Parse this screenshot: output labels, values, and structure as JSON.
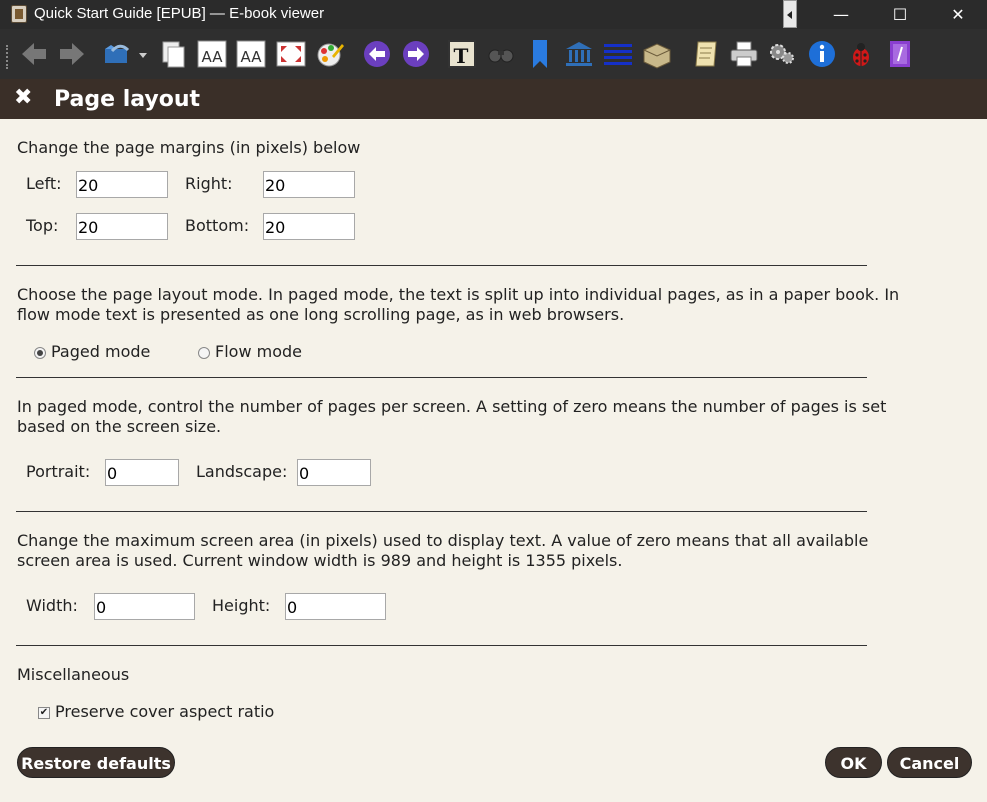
{
  "window": {
    "title": "Quick Start Guide [EPUB] — E-book viewer",
    "minimize": "—",
    "maximize": "☐",
    "close": "✕"
  },
  "toolbar": {
    "icons": [
      "back-icon",
      "forward-icon",
      "open-ebook-icon",
      "dropdown-arrow-icon",
      "copy-icon",
      "font-larger-icon",
      "font-smaller-icon",
      "fullscreen-icon",
      "color-schemes-icon",
      "previous-page-icon",
      "next-page-icon",
      "font-settings-icon",
      "find-icon",
      "bookmark-icon",
      "reference-mode-icon",
      "table-of-contents-icon",
      "page-layout-icon",
      "scroll-icon",
      "print-icon",
      "preferences-icon",
      "info-icon",
      "debug-icon",
      "theme-icon"
    ]
  },
  "panel": {
    "close_glyph": "✖",
    "title": "Page layout"
  },
  "margins": {
    "heading": "Change the page margins (in pixels) below",
    "left_label": "Left:",
    "left_value": "20",
    "right_label": "Right:",
    "right_value": "20",
    "top_label": "Top:",
    "top_value": "20",
    "bottom_label": "Bottom:",
    "bottom_value": "20"
  },
  "layout_mode": {
    "desc_line1": "Choose the page layout mode. In paged mode, the text is split up into individual pages, as in a paper book. In",
    "desc_line2": "flow mode text is presented as one long scrolling page, as in web browsers.",
    "paged_label": "Paged mode",
    "flow_label": "Flow mode",
    "selected": "paged"
  },
  "pages_per_screen": {
    "desc_line1": "In paged mode, control the number of pages per screen. A setting of zero means the number of pages is set",
    "desc_line2": "based on the screen size.",
    "portrait_label": "Portrait:",
    "portrait_value": "0",
    "landscape_label": "Landscape:",
    "landscape_value": "0"
  },
  "screen_area": {
    "desc_line1": "Change the maximum screen area (in pixels) used to display text. A value of zero means that all available",
    "desc_line2": "screen area is used. Current window width is 989 and height is 1355 pixels.",
    "width_label": "Width:",
    "width_value": "0",
    "height_label": "Height:",
    "height_value": "0"
  },
  "misc": {
    "heading": "Miscellaneous",
    "preserve_cover_label": "Preserve cover aspect ratio",
    "preserve_cover_checked": true
  },
  "buttons": {
    "restore_defaults": "Restore defaults",
    "ok": "OK",
    "cancel": "Cancel"
  }
}
